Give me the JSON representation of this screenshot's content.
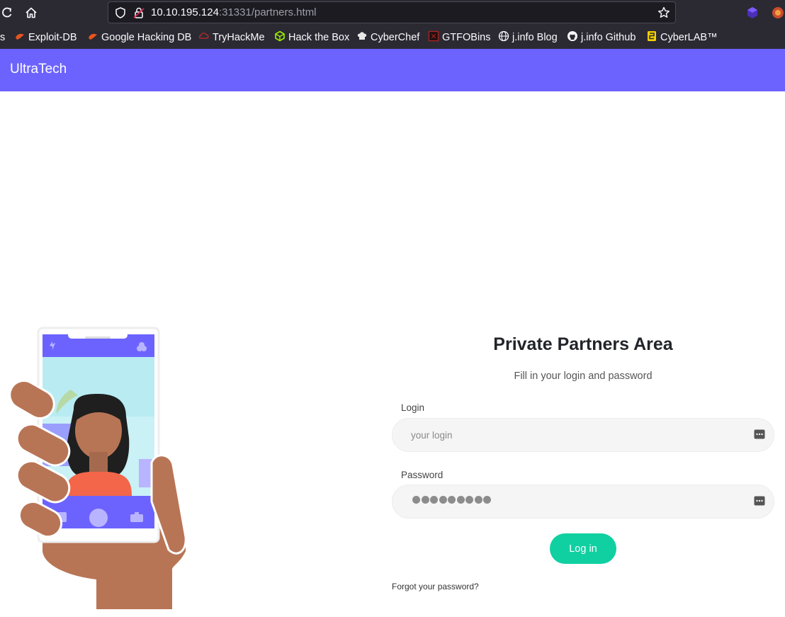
{
  "browser": {
    "url_host": "10.10.195.124",
    "url_rest": ":31331/partners.html",
    "bookmarks": [
      {
        "label": "s",
        "icon": "truncated-bookmark-icon"
      },
      {
        "label": "Exploit-DB",
        "icon": "exploit-db-icon"
      },
      {
        "label": "Google Hacking DB",
        "icon": "ghdb-icon"
      },
      {
        "label": "TryHackMe",
        "icon": "tryhackme-icon"
      },
      {
        "label": "Hack the Box",
        "icon": "hackthebox-icon"
      },
      {
        "label": "CyberChef",
        "icon": "cyberchef-icon"
      },
      {
        "label": "GTFOBins",
        "icon": "gtfobins-icon"
      },
      {
        "label": "j.info Blog",
        "icon": "globe-icon"
      },
      {
        "label": "j.info Github",
        "icon": "github-icon"
      },
      {
        "label": "CyberLAB™",
        "icon": "cyberlab-icon"
      }
    ]
  },
  "page": {
    "brand": "UltraTech",
    "title": "Private Partners Area",
    "subtitle": "Fill in your login and password",
    "login_label": "Login",
    "login_placeholder": "your login",
    "login_value": "",
    "password_label": "Password",
    "password_masked_count": 9,
    "login_button": "Log in",
    "forgot_link": "Forgot your password?"
  },
  "colors": {
    "navbar": "#6c63ff",
    "button": "#10d0a1",
    "skin": "#b87556",
    "phone_accent": "#6c63ff"
  }
}
